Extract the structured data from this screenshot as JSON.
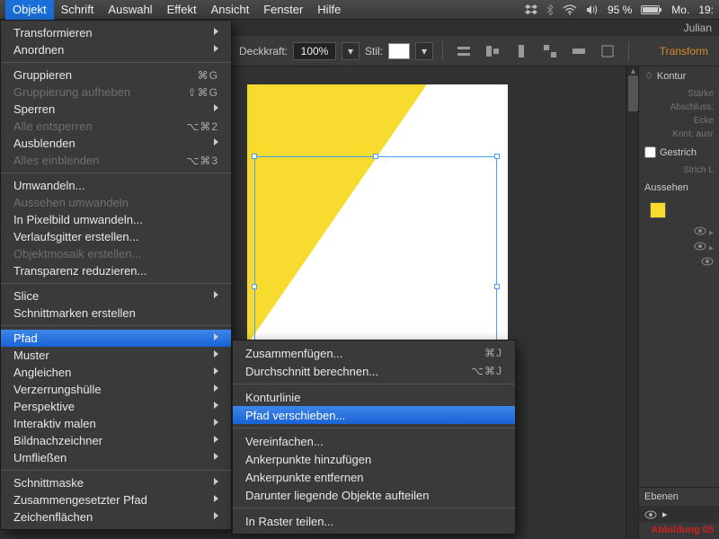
{
  "menubar": {
    "items": [
      "Objekt",
      "Schrift",
      "Auswahl",
      "Effekt",
      "Ansicht",
      "Fenster",
      "Hilfe"
    ],
    "active_index": 0
  },
  "status": {
    "battery": "95 %",
    "day": "Mo.",
    "time": "19:"
  },
  "titlebar": {
    "user": "Julian"
  },
  "controlbar": {
    "opacity_label": "Deckkraft:",
    "opacity_value": "100%",
    "style_label": "Stil:",
    "transform_tab": "Transform"
  },
  "objekt_menu": [
    {
      "label": "Transformieren",
      "submenu": true
    },
    {
      "label": "Anordnen",
      "submenu": true
    },
    {
      "hr": true
    },
    {
      "label": "Gruppieren",
      "shortcut": "⌘G"
    },
    {
      "label": "Gruppierung aufheben",
      "shortcut": "⇧⌘G",
      "disabled": true
    },
    {
      "label": "Sperren",
      "submenu": true
    },
    {
      "label": "Alle entsperren",
      "shortcut": "⌥⌘2",
      "disabled": true
    },
    {
      "label": "Ausblenden",
      "submenu": true
    },
    {
      "label": "Alles einblenden",
      "shortcut": "⌥⌘3",
      "disabled": true
    },
    {
      "hr": true
    },
    {
      "label": "Umwandeln..."
    },
    {
      "label": "Aussehen umwandeln",
      "disabled": true
    },
    {
      "label": "In Pixelbild umwandeln..."
    },
    {
      "label": "Verlaufsgitter erstellen..."
    },
    {
      "label": "Objektmosaik erstellen...",
      "disabled": true
    },
    {
      "label": "Transparenz reduzieren..."
    },
    {
      "hr": true
    },
    {
      "label": "Slice",
      "submenu": true
    },
    {
      "label": "Schnittmarken erstellen"
    },
    {
      "hr": true
    },
    {
      "label": "Pfad",
      "submenu": true,
      "highlighted": true
    },
    {
      "label": "Muster",
      "submenu": true
    },
    {
      "label": "Angleichen",
      "submenu": true
    },
    {
      "label": "Verzerrungshülle",
      "submenu": true
    },
    {
      "label": "Perspektive",
      "submenu": true
    },
    {
      "label": "Interaktiv malen",
      "submenu": true
    },
    {
      "label": "Bildnachzeichner",
      "submenu": true
    },
    {
      "label": "Umfließen",
      "submenu": true
    },
    {
      "hr": true
    },
    {
      "label": "Schnittmaske",
      "submenu": true
    },
    {
      "label": "Zusammengesetzter Pfad",
      "submenu": true
    },
    {
      "label": "Zeichenflächen",
      "submenu": true
    }
  ],
  "pfad_submenu": [
    {
      "label": "Zusammenfügen...",
      "shortcut": "⌘J"
    },
    {
      "label": "Durchschnitt berechnen...",
      "shortcut": "⌥⌘J"
    },
    {
      "hr": true
    },
    {
      "label": "Konturlinie"
    },
    {
      "label": "Pfad verschieben...",
      "highlighted": true
    },
    {
      "hr": true
    },
    {
      "label": "Vereinfachen..."
    },
    {
      "label": "Ankerpunkte hinzufügen"
    },
    {
      "label": "Ankerpunkte entfernen"
    },
    {
      "label": "Darunter liegende Objekte aufteilen"
    },
    {
      "hr": true
    },
    {
      "label": "In Raster teilen..."
    }
  ],
  "panels": {
    "kontur": {
      "title": "Kontur",
      "rows": [
        "Stärke",
        "Abschluss:",
        "Ecke",
        "Kont. ausr"
      ]
    },
    "gestrichelt": {
      "title": "Gestrich",
      "rows": [
        "Strich   L"
      ]
    },
    "aussehen": {
      "title": "Aussehen"
    },
    "ebenen": {
      "title": "Ebenen"
    }
  },
  "footer_note": "Abbildung 05"
}
